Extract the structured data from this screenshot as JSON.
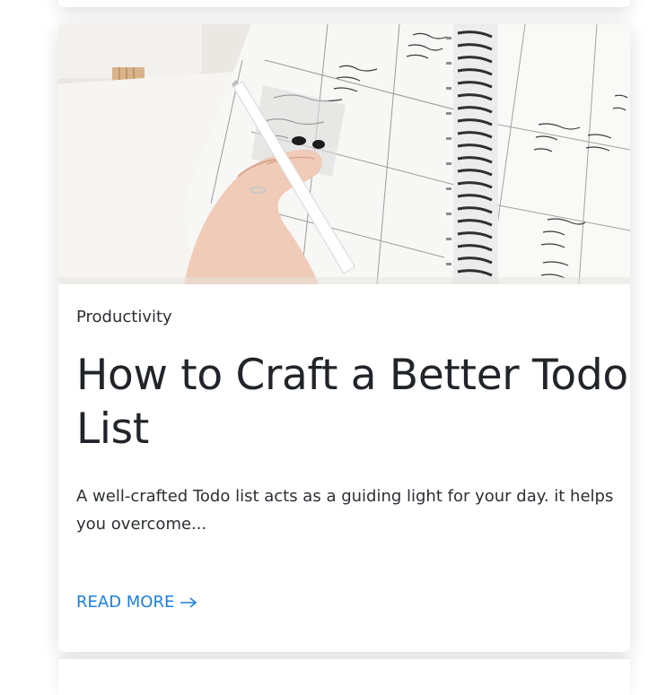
{
  "post": {
    "category": "Productivity",
    "title": "How to Craft a Better Todo List",
    "excerpt": "A well-crafted Todo list acts as a guiding light for your day. it helps you overcome...",
    "read_more_label": "READ MORE",
    "image_icon": "planner-photo",
    "arrow_icon": "arrow-right-icon"
  },
  "colors": {
    "link": "#1a7fe0",
    "title": "#212529",
    "text": "#2b2f33"
  }
}
